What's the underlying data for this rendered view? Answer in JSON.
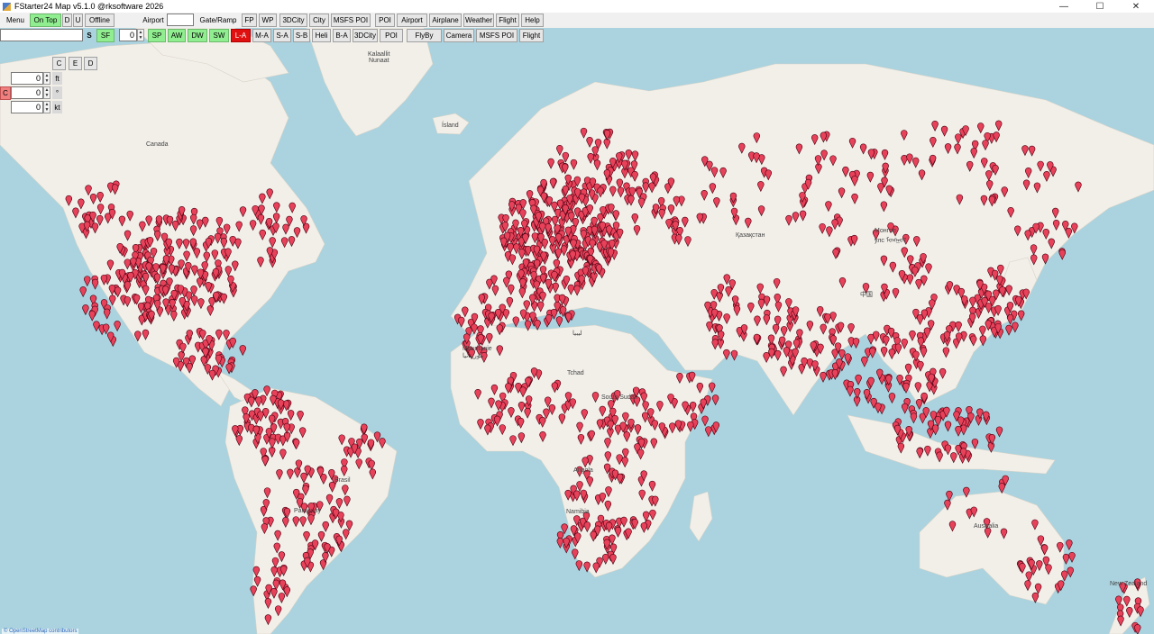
{
  "window": {
    "title": "FStarter24 Map v5.1.0 @rksoftware 2026",
    "controls": {
      "minimize": "—",
      "maximize": "☐",
      "close": "✕"
    }
  },
  "toolbar1": {
    "menu": "Menu",
    "on_top": "On Top",
    "d": "D",
    "u": "U",
    "offline": "Offline",
    "airport_label": "Airport",
    "airport_value": "",
    "gate_ramp": "Gate/Ramp",
    "fp": "FP",
    "wp": "WP",
    "city3d": "3DCity",
    "city": "City",
    "msfs_poi": "MSFS POI",
    "poi": "POI",
    "airport": "Airport",
    "airplane": "Airplane",
    "weather": "Weather",
    "flight": "Flight",
    "help": "Help"
  },
  "toolbar2": {
    "search_value": "",
    "s": "S",
    "sf": "SF",
    "count_value": "0",
    "sp": "SP",
    "aw": "AW",
    "dw": "DW",
    "sw": "SW",
    "la": "L-A",
    "ma": "M-A",
    "sa": "S-A",
    "sb": "S-B",
    "heli": "Heli",
    "ba": "B-A",
    "city3d": "3DCity",
    "poi": "POI",
    "flyby": "FlyBy",
    "camera": "Camera",
    "msfs_poi": "MSFS POI",
    "flight": "Flight"
  },
  "panel": {
    "c": "C",
    "e": "E",
    "d": "D",
    "c_red": "C",
    "altitude_value": "0",
    "altitude_unit": "ft",
    "heading_value": "0",
    "heading_unit": "°",
    "speed_value": "0",
    "speed_unit": "kt"
  },
  "map": {
    "labels": {
      "canada": "Canada",
      "kalaallit": "Kalaallit\nNunaat",
      "island": "Ísland",
      "kazakhstan": "Қазақстан",
      "mongolia": "Монгол\nулс ᠮᠣᠩᠭᠣᠯ",
      "china": "中国",
      "mauritanie": "Mauritanie\nموريتانيا",
      "libya": "ليبيا",
      "chad": "Tchad",
      "south_sudan": "South Sudan",
      "angola": "Angola",
      "namibia": "Namibia",
      "australia": "Australia",
      "brazil": "Brasil",
      "paraguay": "Paraguay",
      "new_zealand": "New Zealand"
    },
    "attribution": "© OpenStreetMap contributors",
    "colors": {
      "ocean": "#aad3df",
      "land": "#f2efe9",
      "pin": "#e8415a",
      "ice": "#f5f7f8"
    }
  }
}
